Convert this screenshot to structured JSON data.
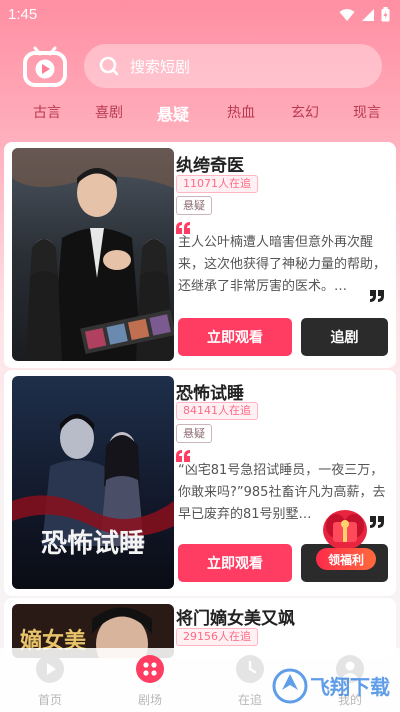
{
  "status_bar": {
    "time": "1:45"
  },
  "search": {
    "placeholder": "搜索短剧"
  },
  "tabs": [
    {
      "label": "古言"
    },
    {
      "label": "喜剧"
    },
    {
      "label": "悬疑",
      "active": true
    },
    {
      "label": "热血"
    },
    {
      "label": "玄幻"
    },
    {
      "label": "现言"
    }
  ],
  "dramas": [
    {
      "title": "纨绔奇医",
      "followers": "11071人在追",
      "tag": "悬疑",
      "description": "主人公叶楠遭人暗害但意外再次醒来，这次他获得了神秘力量的帮助，还继承了非常厉害的医术。…",
      "watch_label": "立即观看",
      "follow_label": "追剧"
    },
    {
      "title": "恐怖试睡",
      "followers": "84141人在追",
      "tag": "悬疑",
      "description": "“凶宅81号急招试睡员，一夜三万，你敢来吗?”985社畜许凡为高薪，去早已废弃的81号别墅…",
      "poster_title": "恐怖试睡",
      "watch_label": "立即观看",
      "follow_label": "追剧"
    },
    {
      "title": "将门嫡女美又飒",
      "followers": "29156人在追",
      "poster_title": "嫡女美"
    }
  ],
  "gift": {
    "label": "领福利"
  },
  "bottom_nav": [
    {
      "label": "首页"
    },
    {
      "label": "剧场",
      "active": true
    },
    {
      "label": "在追"
    },
    {
      "label": "我的"
    }
  ],
  "watermark": {
    "text": "飞翔下载"
  },
  "colors": {
    "accent": "#ff3d63",
    "dark_button": "#2b2b2b",
    "header_pink": "#ff8fa3"
  }
}
